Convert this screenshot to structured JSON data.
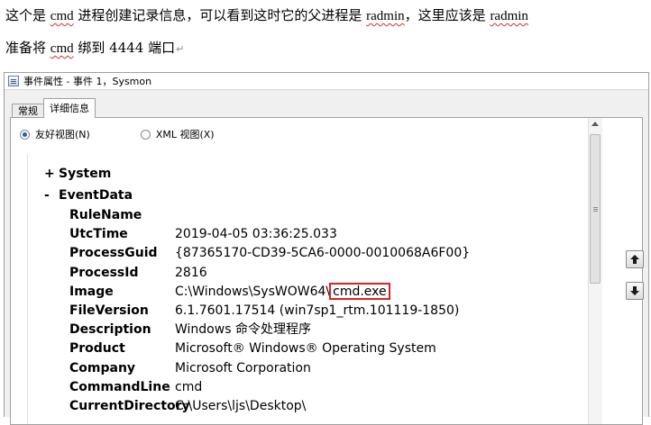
{
  "doc": {
    "line1": {
      "p1": "这个是 ",
      "w1": "cmd",
      "p2": " 进程创建记录信息，可以看到这时它的父进程是 ",
      "w2": "radmin",
      "p3": "，这里应该是 ",
      "w3": "radmin"
    },
    "line2": {
      "p1": "准备将 ",
      "w1": "cmd",
      "p2": " 绑到 4444 端口",
      "mark": "↵"
    },
    "line1_mark": ""
  },
  "window": {
    "title": "事件属性 - 事件 1，Sysmon",
    "tabs": [
      {
        "label": "常规"
      },
      {
        "label": "详细信息"
      }
    ],
    "views": {
      "friendly": "友好视图(N)",
      "xml": "XML 视图(X)"
    }
  },
  "tree": {
    "system": {
      "toggle": "+",
      "label": "System"
    },
    "eventdata": {
      "toggle": "-",
      "label": "EventData"
    },
    "fields": [
      {
        "key": "RuleName",
        "value": ""
      },
      {
        "key": "UtcTime",
        "value": "2019-04-05 03:36:25.033"
      },
      {
        "key": "ProcessGuid",
        "value": "{87365170-CD39-5CA6-0000-0010068A6F00}"
      },
      {
        "key": "ProcessId",
        "value": "2816"
      },
      {
        "key": "Image",
        "value": "C:\\Windows\\SysWOW64\\",
        "highlight": "cmd.exe"
      },
      {
        "key": "FileVersion",
        "value": "6.1.7601.17514 (win7sp1_rtm.101119-1850)"
      },
      {
        "key": "Description",
        "value": "Windows 命令处理程序"
      },
      {
        "key": "Product",
        "value": "Microsoft® Windows® Operating System"
      },
      {
        "key": "Company",
        "value": "Microsoft Corporation"
      },
      {
        "key": "CommandLine",
        "value": "cmd"
      },
      {
        "key": "CurrentDirectory",
        "value": "C:\\Users\\ljs\\Desktop\\"
      }
    ]
  },
  "colors": {
    "highlight_border": "#e02020",
    "radio_dot": "#2a5ea8"
  }
}
